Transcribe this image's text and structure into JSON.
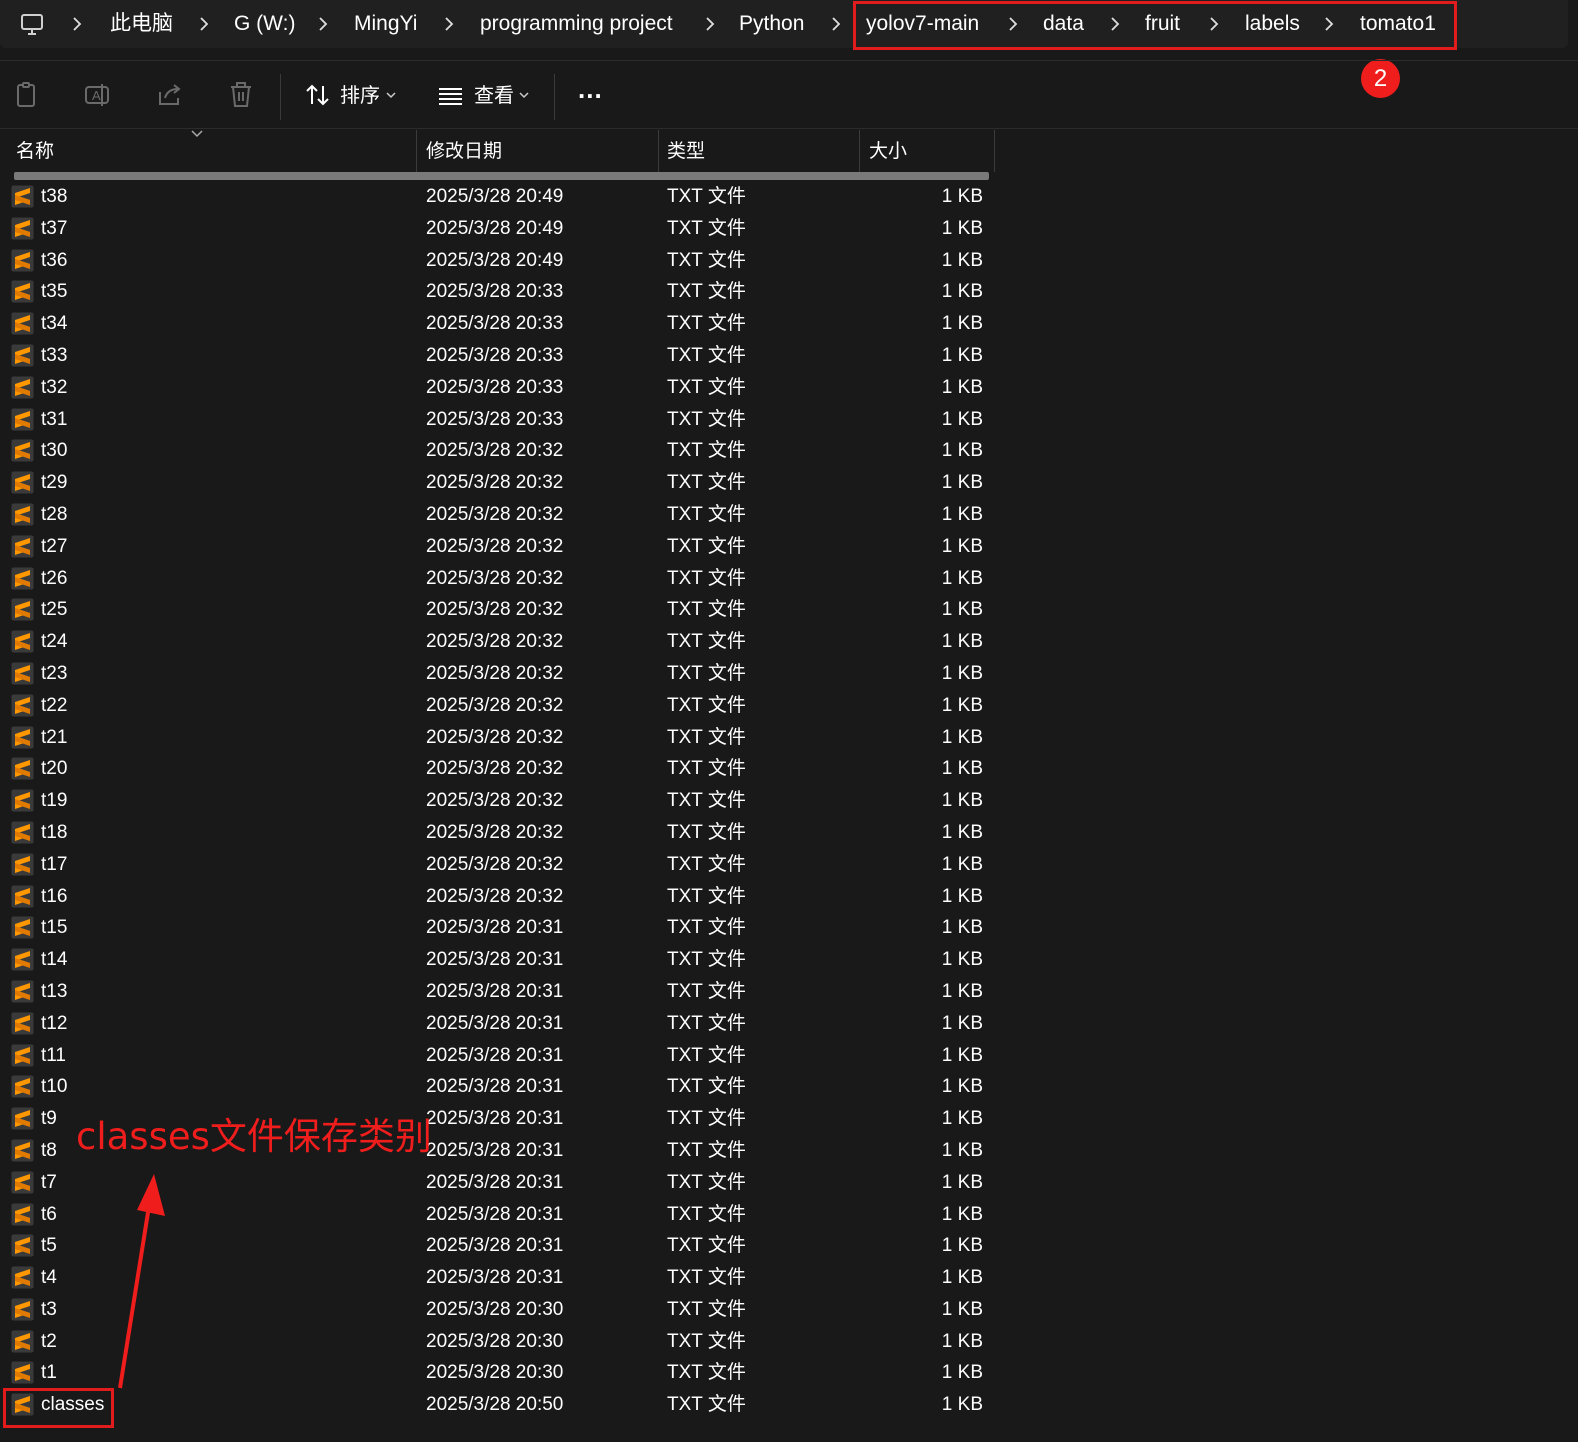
{
  "breadcrumb": {
    "items": [
      "此电脑",
      "G (W:)",
      "MingYi",
      "programming project",
      "Python",
      "yolov7-main",
      "data",
      "fruit",
      "labels",
      "tomato1"
    ]
  },
  "annotations": {
    "badge_number": "2",
    "note": "classes文件保存类别",
    "highlight_color": "#e21c1c"
  },
  "toolbar": {
    "icons": [
      "copy-icon",
      "rename-icon",
      "share-icon",
      "delete-icon"
    ],
    "sort_label": "排序",
    "view_label": "查看",
    "more_label": "..."
  },
  "columns": {
    "name": "名称",
    "date": "修改日期",
    "type": "类型",
    "size": "大小"
  },
  "files": [
    {
      "name": "t38",
      "date": "2025/3/28 20:49",
      "type": "TXT 文件",
      "size": "1 KB"
    },
    {
      "name": "t37",
      "date": "2025/3/28 20:49",
      "type": "TXT 文件",
      "size": "1 KB"
    },
    {
      "name": "t36",
      "date": "2025/3/28 20:49",
      "type": "TXT 文件",
      "size": "1 KB"
    },
    {
      "name": "t35",
      "date": "2025/3/28 20:33",
      "type": "TXT 文件",
      "size": "1 KB"
    },
    {
      "name": "t34",
      "date": "2025/3/28 20:33",
      "type": "TXT 文件",
      "size": "1 KB"
    },
    {
      "name": "t33",
      "date": "2025/3/28 20:33",
      "type": "TXT 文件",
      "size": "1 KB"
    },
    {
      "name": "t32",
      "date": "2025/3/28 20:33",
      "type": "TXT 文件",
      "size": "1 KB"
    },
    {
      "name": "t31",
      "date": "2025/3/28 20:33",
      "type": "TXT 文件",
      "size": "1 KB"
    },
    {
      "name": "t30",
      "date": "2025/3/28 20:32",
      "type": "TXT 文件",
      "size": "1 KB"
    },
    {
      "name": "t29",
      "date": "2025/3/28 20:32",
      "type": "TXT 文件",
      "size": "1 KB"
    },
    {
      "name": "t28",
      "date": "2025/3/28 20:32",
      "type": "TXT 文件",
      "size": "1 KB"
    },
    {
      "name": "t27",
      "date": "2025/3/28 20:32",
      "type": "TXT 文件",
      "size": "1 KB"
    },
    {
      "name": "t26",
      "date": "2025/3/28 20:32",
      "type": "TXT 文件",
      "size": "1 KB"
    },
    {
      "name": "t25",
      "date": "2025/3/28 20:32",
      "type": "TXT 文件",
      "size": "1 KB"
    },
    {
      "name": "t24",
      "date": "2025/3/28 20:32",
      "type": "TXT 文件",
      "size": "1 KB"
    },
    {
      "name": "t23",
      "date": "2025/3/28 20:32",
      "type": "TXT 文件",
      "size": "1 KB"
    },
    {
      "name": "t22",
      "date": "2025/3/28 20:32",
      "type": "TXT 文件",
      "size": "1 KB"
    },
    {
      "name": "t21",
      "date": "2025/3/28 20:32",
      "type": "TXT 文件",
      "size": "1 KB"
    },
    {
      "name": "t20",
      "date": "2025/3/28 20:32",
      "type": "TXT 文件",
      "size": "1 KB"
    },
    {
      "name": "t19",
      "date": "2025/3/28 20:32",
      "type": "TXT 文件",
      "size": "1 KB"
    },
    {
      "name": "t18",
      "date": "2025/3/28 20:32",
      "type": "TXT 文件",
      "size": "1 KB"
    },
    {
      "name": "t17",
      "date": "2025/3/28 20:32",
      "type": "TXT 文件",
      "size": "1 KB"
    },
    {
      "name": "t16",
      "date": "2025/3/28 20:32",
      "type": "TXT 文件",
      "size": "1 KB"
    },
    {
      "name": "t15",
      "date": "2025/3/28 20:31",
      "type": "TXT 文件",
      "size": "1 KB"
    },
    {
      "name": "t14",
      "date": "2025/3/28 20:31",
      "type": "TXT 文件",
      "size": "1 KB"
    },
    {
      "name": "t13",
      "date": "2025/3/28 20:31",
      "type": "TXT 文件",
      "size": "1 KB"
    },
    {
      "name": "t12",
      "date": "2025/3/28 20:31",
      "type": "TXT 文件",
      "size": "1 KB"
    },
    {
      "name": "t11",
      "date": "2025/3/28 20:31",
      "type": "TXT 文件",
      "size": "1 KB"
    },
    {
      "name": "t10",
      "date": "2025/3/28 20:31",
      "type": "TXT 文件",
      "size": "1 KB"
    },
    {
      "name": "t9",
      "date": "2025/3/28 20:31",
      "type": "TXT 文件",
      "size": "1 KB"
    },
    {
      "name": "t8",
      "date": "2025/3/28 20:31",
      "type": "TXT 文件",
      "size": "1 KB"
    },
    {
      "name": "t7",
      "date": "2025/3/28 20:31",
      "type": "TXT 文件",
      "size": "1 KB"
    },
    {
      "name": "t6",
      "date": "2025/3/28 20:31",
      "type": "TXT 文件",
      "size": "1 KB"
    },
    {
      "name": "t5",
      "date": "2025/3/28 20:31",
      "type": "TXT 文件",
      "size": "1 KB"
    },
    {
      "name": "t4",
      "date": "2025/3/28 20:31",
      "type": "TXT 文件",
      "size": "1 KB"
    },
    {
      "name": "t3",
      "date": "2025/3/28 20:30",
      "type": "TXT 文件",
      "size": "1 KB"
    },
    {
      "name": "t2",
      "date": "2025/3/28 20:30",
      "type": "TXT 文件",
      "size": "1 KB"
    },
    {
      "name": "t1",
      "date": "2025/3/28 20:30",
      "type": "TXT 文件",
      "size": "1 KB"
    },
    {
      "name": "classes",
      "date": "2025/3/28 20:50",
      "type": "TXT 文件",
      "size": "1 KB"
    }
  ],
  "file_icon": "sublime-text-file-icon",
  "colors": {
    "background": "#191919",
    "text": "#ffffff",
    "annotation_red": "#f01d1d",
    "file_icon_orange": "#ff9800"
  }
}
